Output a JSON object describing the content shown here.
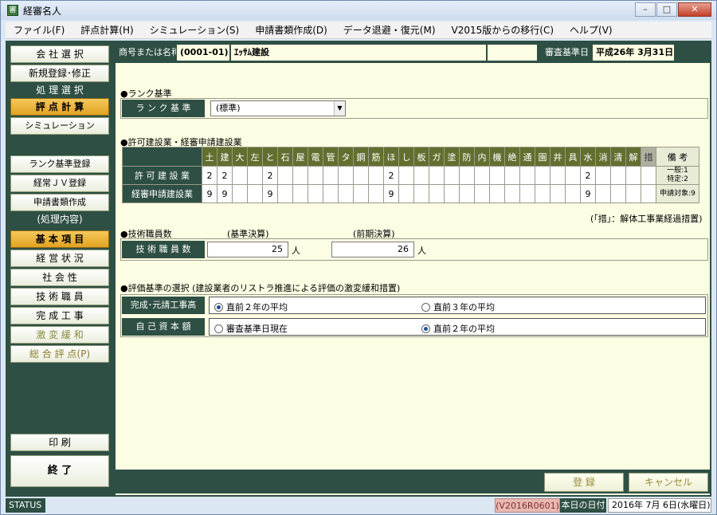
{
  "window": {
    "title": "経審名人",
    "app_icon": "審"
  },
  "menu": [
    "ファイル(F)",
    "評点計算(H)",
    "シミュレーション(S)",
    "申請書類作成(D)",
    "データ退避・復元(M)",
    "V2015版からの移行(C)",
    "ヘルプ(V)"
  ],
  "sidebar": {
    "company_select": "会 社 選 択",
    "new_register": "新規登録･修正",
    "head_processing": "処 理 選 択",
    "score_calc": "評 点 計 算",
    "simulation": "シミュレーション",
    "rank_register": "ランク基準登録",
    "jv_register": "経常ＪＶ登録",
    "docs_create": "申請書類作成",
    "head_content": "(処理内容)",
    "basic_items": "基 本 項 目",
    "business_status": "経 営 状 況",
    "social": "社 会 性",
    "engineers": "技 術 職 員",
    "completed_work": "完 成 工 事",
    "mitigation": "激 変 緩 和",
    "total_score": "総 合 評 点(P)",
    "print": "印 刷",
    "exit": "終 了"
  },
  "header": {
    "name_label": "商号または名称",
    "company_code": "(0001-01)",
    "company_name": "ｴｯｻﾑ建設",
    "date_label": "審査基準日",
    "date_value": "平成26年 3月31日"
  },
  "rank": {
    "section_title": "●ランク基準",
    "label": "ラ ン ク 基 準",
    "selected": "(標準)"
  },
  "license": {
    "section_title": "●許可建設業・経審申請建設業",
    "columns": [
      "土",
      "建",
      "大",
      "左",
      "と",
      "石",
      "屋",
      "電",
      "管",
      "タ",
      "鋼",
      "筋",
      "ほ",
      "し",
      "板",
      "ガ",
      "塗",
      "防",
      "内",
      "機",
      "絶",
      "通",
      "園",
      "井",
      "具",
      "水",
      "消",
      "清",
      "解",
      "措"
    ],
    "biko_header": "備 考",
    "rows": [
      {
        "label": "許 可 建 設 業",
        "values": [
          "2",
          "2",
          "",
          "",
          "2",
          "",
          "",
          "",
          "",
          "",
          "",
          "",
          "2",
          "",
          "",
          "",
          "",
          "",
          "",
          "",
          "",
          "",
          "",
          "",
          "",
          "2",
          "",
          "",
          "",
          ""
        ],
        "note1": "一般:1",
        "note2": "特定:2"
      },
      {
        "label": "経審申請建設業",
        "values": [
          "9",
          "9",
          "",
          "",
          "9",
          "",
          "",
          "",
          "",
          "",
          "",
          "",
          "9",
          "",
          "",
          "",
          "",
          "",
          "",
          "",
          "",
          "",
          "",
          "",
          "",
          "9",
          "",
          "",
          "",
          ""
        ],
        "note1": "申請対象:9",
        "note2": ""
      }
    ],
    "footnote": "(｢措｣：解体工事業経過措置)"
  },
  "engineers": {
    "section_title": "●技術職員数",
    "base_label": "(基準決算)",
    "prev_label": "(前期決算)",
    "row_label": "技 術 職 員 数",
    "base_value": "25",
    "prev_value": "26",
    "unit": "人"
  },
  "evaluation": {
    "section_title": "●評価基準の選択 (建設業者のリストラ推進による評価の激変緩和措置)",
    "row1_label": "完成･元請工事高",
    "row1_opt1": "直前２年の平均",
    "row1_opt2": "直前３年の平均",
    "row2_label": "自 己 資 本 額",
    "row2_opt1": "審査基準日現在",
    "row2_opt2": "直前２年の平均"
  },
  "footer": {
    "register": "登 録",
    "cancel": "キャンセル"
  },
  "status": {
    "label": "STATUS",
    "version": "(V2016R0601)",
    "today_label": "本日の日付",
    "today": "2016年 7月 6日(水曜日)"
  }
}
